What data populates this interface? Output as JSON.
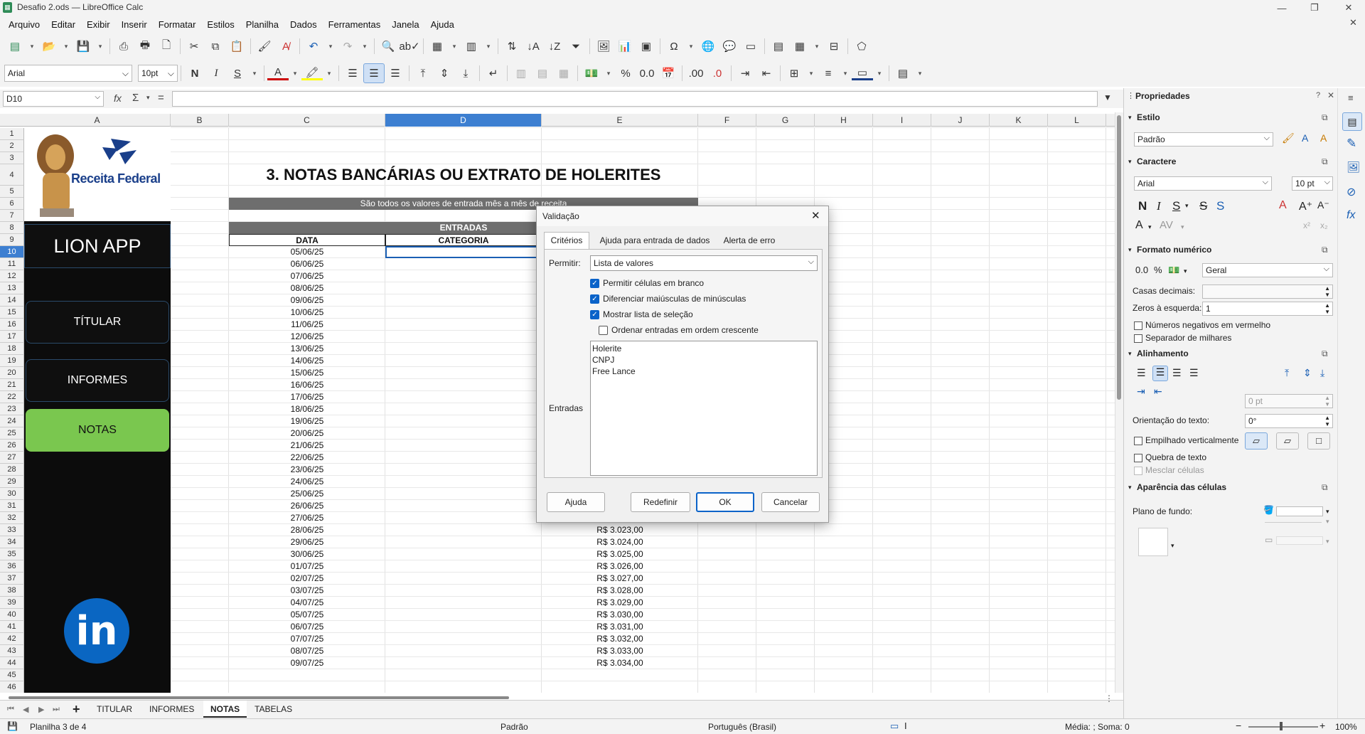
{
  "window": {
    "title": "Desafio 2.ods — LibreOffice Calc"
  },
  "menu": [
    "Arquivo",
    "Editar",
    "Exibir",
    "Inserir",
    "Formatar",
    "Estilos",
    "Planilha",
    "Dados",
    "Ferramentas",
    "Janela",
    "Ajuda"
  ],
  "toolbar": {
    "font_name": "Arial",
    "font_size": "10pt",
    "bold": "N",
    "italic": "I",
    "underline": "S"
  },
  "formula": {
    "cell_ref": "D10",
    "fx": "fx",
    "sigma": "Σ",
    "equals": "="
  },
  "columns": [
    "A",
    "B",
    "C",
    "D",
    "E",
    "F",
    "G",
    "H",
    "I",
    "J",
    "K",
    "L"
  ],
  "rows": [
    "1",
    "2",
    "3",
    "4",
    "5",
    "6",
    "7",
    "8",
    "9",
    "10",
    "11",
    "12",
    "13",
    "14",
    "15",
    "16",
    "17",
    "18",
    "19",
    "20",
    "21",
    "22",
    "23",
    "24",
    "25",
    "26",
    "27",
    "28",
    "29",
    "30",
    "31",
    "32",
    "33",
    "34",
    "35",
    "36",
    "37",
    "38",
    "39",
    "40",
    "41",
    "42",
    "43",
    "44",
    "45",
    "46"
  ],
  "sheet": {
    "heading": "3. NOTAS BANCÁRIAS OU EXTRATO DE HOLERITES",
    "banner": "São todos os valores de entrada mês a mês de receita",
    "entradas": "ENTRADAS",
    "col_data": "DATA",
    "col_categoria": "CATEGORIA",
    "dates": [
      "05/06/25",
      "06/06/25",
      "07/06/25",
      "08/06/25",
      "09/06/25",
      "10/06/25",
      "11/06/25",
      "12/06/25",
      "13/06/25",
      "14/06/25",
      "15/06/25",
      "16/06/25",
      "17/06/25",
      "18/06/25",
      "19/06/25",
      "20/06/25",
      "21/06/25",
      "22/06/25",
      "23/06/25",
      "24/06/25",
      "25/06/25",
      "26/06/25",
      "27/06/25",
      "28/06/25",
      "29/06/25",
      "30/06/25",
      "01/07/25",
      "02/07/25",
      "03/07/25",
      "04/07/25",
      "05/07/25",
      "06/07/25",
      "07/07/25",
      "08/07/25",
      "09/07/25"
    ],
    "values_visible": [
      "R$ 3.023,00",
      "R$ 3.024,00",
      "R$ 3.025,00",
      "R$ 3.026,00",
      "R$ 3.027,00",
      "R$ 3.028,00",
      "R$ 3.029,00",
      "R$ 3.030,00",
      "R$ 3.031,00",
      "R$ 3.032,00",
      "R$ 3.033,00",
      "R$ 3.034,00"
    ]
  },
  "leftpanel": {
    "brand": "Receita Federal",
    "app": "LION APP",
    "nav": [
      "TÍTULAR",
      "INFORMES",
      "NOTAS"
    ],
    "linkedin": "in"
  },
  "dialog": {
    "title": "Validação",
    "tabs": [
      "Critérios",
      "Ajuda para entrada de dados",
      "Alerta de erro"
    ],
    "permitir_label": "Permitir:",
    "permitir_value": "Lista de valores",
    "checks": [
      {
        "label": "Permitir células em branco",
        "checked": true
      },
      {
        "label": "Diferenciar maiúsculas de minúsculas",
        "checked": true
      },
      {
        "label": "Mostrar lista de seleção",
        "checked": true
      },
      {
        "label": "Ordenar entradas em ordem crescente",
        "checked": false
      }
    ],
    "entradas_label": "Entradas",
    "entries": [
      "Holerite",
      "CNPJ",
      "Free Lance"
    ],
    "buttons": {
      "help": "Ajuda",
      "reset": "Redefinir",
      "ok": "OK",
      "cancel": "Cancelar"
    }
  },
  "sidebar": {
    "title": "Propriedades",
    "estilo": {
      "heading": "Estilo",
      "value": "Padrão"
    },
    "caractere": {
      "heading": "Caractere",
      "font": "Arial",
      "size": "10 pt",
      "bold": "N",
      "italic": "I",
      "underline": "S",
      "strike": "S",
      "shadow": "S"
    },
    "formato": {
      "heading": "Formato numérico",
      "percent": "%",
      "value": "Geral",
      "casas_label": "Casas decimais:",
      "zeros_label": "Zeros à esquerda:",
      "zeros_value": "1",
      "neg_label": "Números negativos em vermelho",
      "sep_label": "Separador de milhares"
    },
    "alinhamento": {
      "heading": "Alinhamento",
      "indent": "0 pt",
      "orient_label": "Orientação do texto:",
      "orient_value": "0°",
      "stack_label": "Empilhado verticalmente",
      "wrap_label": "Quebra de texto",
      "merge_label": "Mesclar células"
    },
    "aparencia": {
      "heading": "Aparência das células",
      "bg_label": "Plano de fundo:"
    }
  },
  "tabs": [
    "TITULAR",
    "INFORMES",
    "NOTAS",
    "TABELAS"
  ],
  "active_tab": "NOTAS",
  "status": {
    "sheet": "Planilha 3 de 4",
    "style": "Padrão",
    "lang": "Português (Brasil)",
    "sum": "Média: ; Soma: 0",
    "zoom": "100%"
  }
}
